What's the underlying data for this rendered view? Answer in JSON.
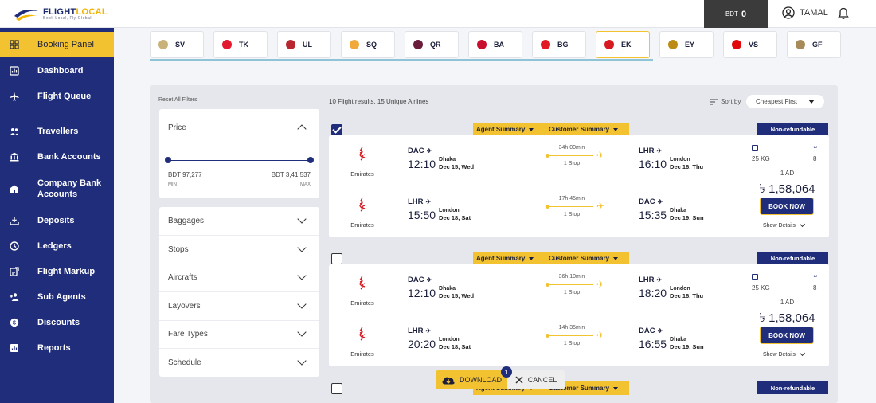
{
  "brand": {
    "name_part1": "FLIGHT",
    "name_part2": "LOCAL",
    "tagline": "Book Local, Fly Global"
  },
  "header": {
    "balance_label": "BDT",
    "balance_value": "0",
    "user_name": "TAMAL"
  },
  "sidebar": {
    "items": [
      {
        "label": "Booking Panel",
        "icon": "grid-icon",
        "active": true
      },
      {
        "label": "Dashboard",
        "icon": "dashboard-icon"
      },
      {
        "label": "Flight Queue",
        "icon": "plane-icon"
      },
      {
        "label": "Travellers",
        "icon": "users-icon"
      },
      {
        "label": "Bank Accounts",
        "icon": "bank-icon"
      },
      {
        "label": "Company Bank Accounts",
        "icon": "building-icon"
      },
      {
        "label": "Deposits",
        "icon": "deposit-icon"
      },
      {
        "label": "Ledgers",
        "icon": "ledger-icon"
      },
      {
        "label": "Flight Markup",
        "icon": "markup-icon"
      },
      {
        "label": "Sub Agents",
        "icon": "add-user-icon"
      },
      {
        "label": "Discounts",
        "icon": "discount-icon"
      },
      {
        "label": "Reports",
        "icon": "reports-icon"
      }
    ]
  },
  "airlines": [
    {
      "code": "SV",
      "color": "#c8b27a"
    },
    {
      "code": "TK",
      "color": "#e3192d"
    },
    {
      "code": "UL",
      "color": "#b8262f"
    },
    {
      "code": "SQ",
      "color": "#f0a93a"
    },
    {
      "code": "QR",
      "color": "#6a1d3a"
    },
    {
      "code": "BA",
      "color": "#c8102e"
    },
    {
      "code": "BG",
      "color": "#e11b22"
    },
    {
      "code": "EK",
      "color": "#d71a21",
      "active": true
    },
    {
      "code": "EY",
      "color": "#bd8b13"
    },
    {
      "code": "VS",
      "color": "#e10a0a"
    },
    {
      "code": "GF",
      "color": "#a88a5a"
    }
  ],
  "filters": {
    "reset_label": "Reset All Filters",
    "price": {
      "title": "Price",
      "min_value": "BDT 97,277",
      "max_value": "BDT 3,41,537",
      "min_label": "MIN",
      "max_label": "MAX"
    },
    "sections": [
      "Baggages",
      "Stops",
      "Aircrafts",
      "Layovers",
      "Fare Types",
      "Schedule"
    ]
  },
  "results": {
    "summary": "10 Flight results, 15 Unique Airlines",
    "sort_label": "Sort by",
    "sort_value": "Cheapest First",
    "agent_summary": "Agent Summary",
    "customer_summary": "Customer Summary",
    "fare_type": "Non-refundable",
    "book_label": "BOOK NOW",
    "details_label": "Show Details",
    "cards": [
      {
        "checked": true,
        "legs": [
          {
            "airline": "Emirates",
            "from_code": "DAC",
            "from_city": "Dhaka",
            "dep_time": "12:10",
            "dep_date": "Dec 15, Wed",
            "duration": "34h 00min",
            "stops": "1 Stop",
            "to_code": "LHR",
            "to_city": "London",
            "arr_time": "16:10",
            "arr_date": "Dec 16, Thu"
          },
          {
            "airline": "Emirates",
            "from_code": "LHR",
            "from_city": "London",
            "dep_time": "15:50",
            "dep_date": "Dec 18, Sat",
            "duration": "17h 45min",
            "stops": "1 Stop",
            "to_code": "DAC",
            "to_city": "Dhaka",
            "arr_time": "15:35",
            "arr_date": "Dec 19, Sun"
          }
        ],
        "baggage": "25 KG",
        "seats": "8",
        "pax": "1 AD",
        "price": "৳ 1,58,064"
      },
      {
        "checked": false,
        "legs": [
          {
            "airline": "Emirates",
            "from_code": "DAC",
            "from_city": "Dhaka",
            "dep_time": "12:10",
            "dep_date": "Dec 15, Wed",
            "duration": "36h 10min",
            "stops": "1 Stop",
            "to_code": "LHR",
            "to_city": "London",
            "arr_time": "18:20",
            "arr_date": "Dec 16, Thu"
          },
          {
            "airline": "Emirates",
            "from_code": "LHR",
            "from_city": "London",
            "dep_time": "20:20",
            "dep_date": "Dec 18, Sat",
            "duration": "14h 35min",
            "stops": "1 Stop",
            "to_code": "DAC",
            "to_city": "Dhaka",
            "arr_time": "16:55",
            "arr_date": "Dec 19, Sun"
          }
        ],
        "baggage": "25 KG",
        "seats": "8",
        "pax": "1 AD",
        "price": "৳ 1,58,064"
      }
    ],
    "third_checked": false
  },
  "actions": {
    "download_label": "DOWNLOAD",
    "download_count": "1",
    "cancel_label": "CANCEL"
  },
  "colors": {
    "primary": "#1f2d7a",
    "accent": "#f2c230"
  }
}
